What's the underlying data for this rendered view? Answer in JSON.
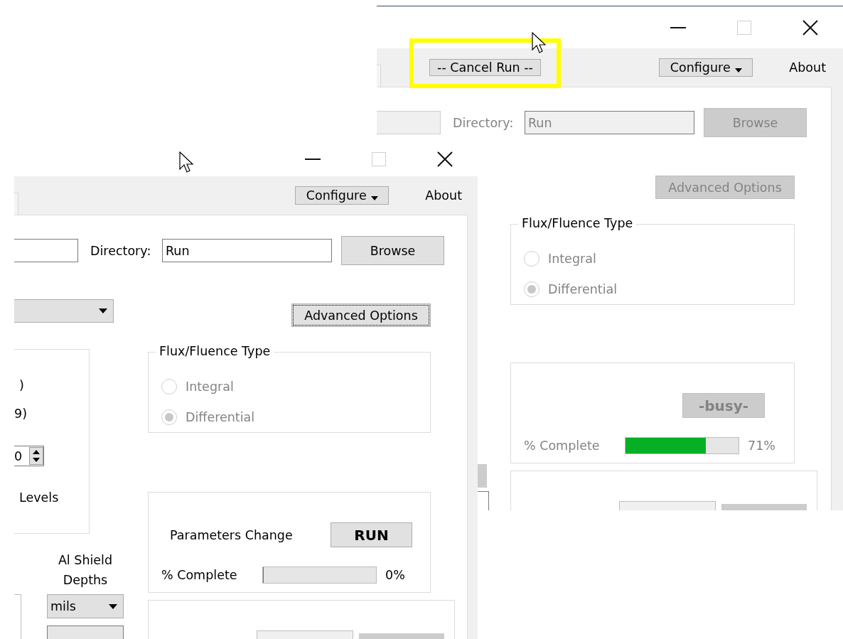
{
  "back_window": {
    "cancel_button": {
      "label": "-- Cancel Run --",
      "highlighted": true
    },
    "menu": [
      {
        "kind": "dropdown",
        "label": "Configure"
      },
      {
        "kind": "link",
        "label": "About"
      }
    ],
    "controls_disabled": true,
    "directory": {
      "label": "Directory:",
      "value": "Run"
    },
    "browse_button": "Browse",
    "advanced_options": {
      "label": "Advanced Options",
      "focused": false
    },
    "flux_group": {
      "title": "Flux/Fluence Type",
      "disabled": true,
      "options": [
        {
          "label": "Integral",
          "selected": false
        },
        {
          "label": "Differential",
          "selected": true
        }
      ]
    },
    "run_panel": {
      "button": "-busy-",
      "progress_label": "% Complete",
      "level": 0.71,
      "reading": "71%"
    }
  },
  "front_window": {
    "menu": [
      {
        "kind": "dropdown",
        "label": "Configure"
      },
      {
        "kind": "link",
        "label": "About"
      }
    ],
    "controls_disabled": false,
    "directory": {
      "label": "Directory:",
      "value": "Run"
    },
    "browse_button": "Browse",
    "advanced_options": {
      "label": "Advanced Options",
      "focused": true
    },
    "left_group": {
      "lines": [
        ")",
        "9)"
      ],
      "spinner_value": "0",
      "caption": "Levels"
    },
    "shield_depths": {
      "label": "Al Shield Depths",
      "unit": "mils"
    },
    "flux_group": {
      "title": "Flux/Fluence Type",
      "disabled": true,
      "options": [
        {
          "label": "Integral",
          "selected": false
        },
        {
          "label": "Differential",
          "selected": true
        }
      ]
    },
    "run_panel": {
      "status": "Parameters Change",
      "button": "RUN",
      "progress_label": "% Complete",
      "level": 0,
      "reading": "0%"
    }
  }
}
